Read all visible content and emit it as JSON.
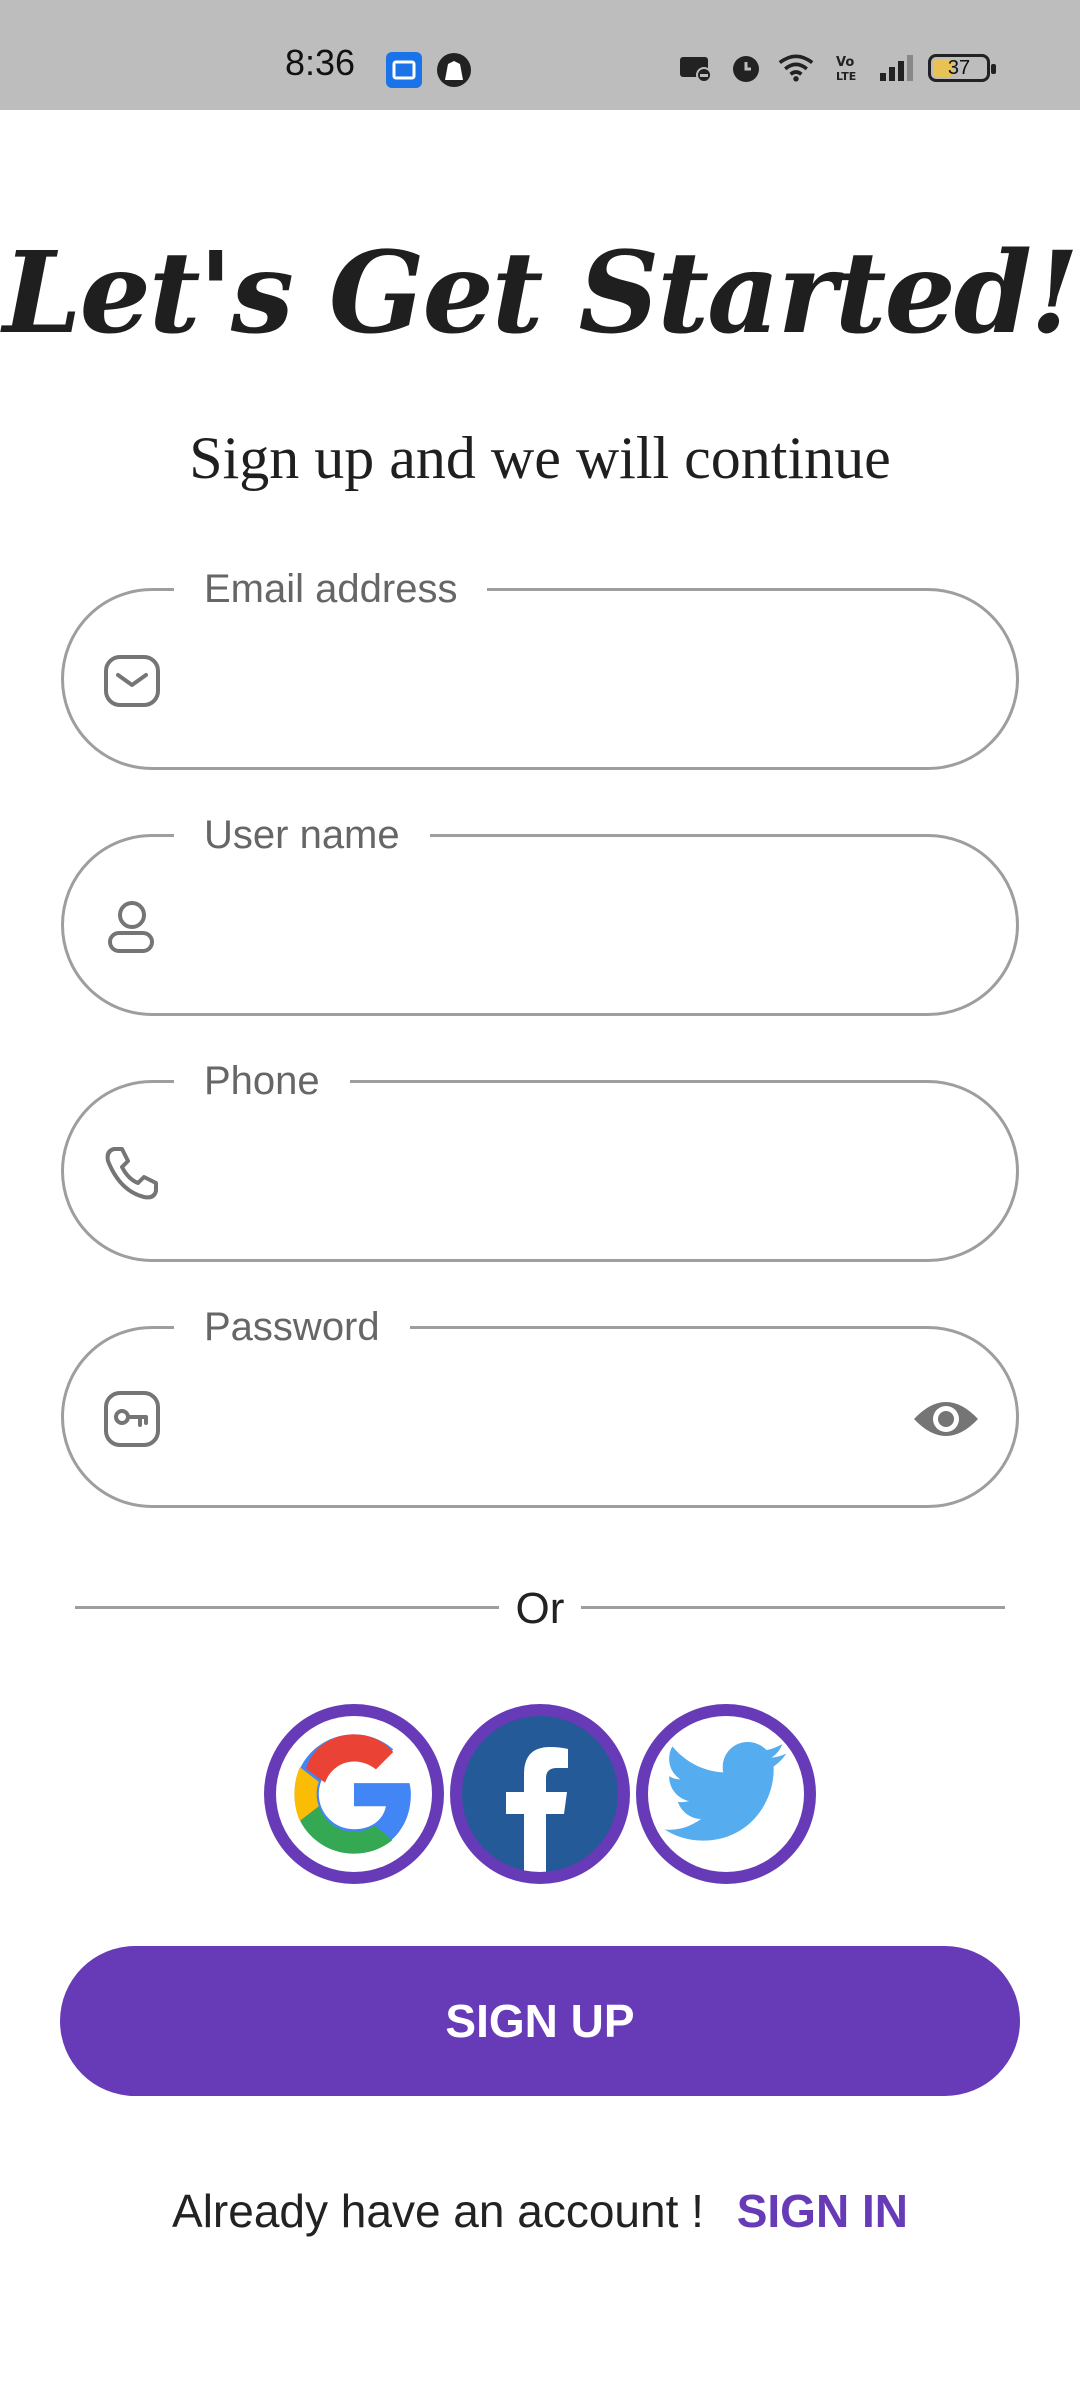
{
  "status_bar": {
    "time": "8:36",
    "battery": "37",
    "icons_left": [
      "app-notification-icon",
      "app-notification-icon-2"
    ],
    "icons_right": [
      "cast-icon",
      "alarm-icon",
      "wifi-icon",
      "volte-icon",
      "signal-icon",
      "battery-icon"
    ]
  },
  "header": {
    "title": "Let's Get Started!",
    "subtitle": "Sign up and we will continue"
  },
  "form": {
    "email": {
      "label": "Email address",
      "value": "",
      "icon": "mail-icon"
    },
    "username": {
      "label": "User name",
      "value": "",
      "icon": "user-icon"
    },
    "phone": {
      "label": "Phone",
      "value": "",
      "icon": "phone-icon"
    },
    "password": {
      "label": "Password",
      "value": "",
      "icon": "key-icon",
      "toggle_icon": "eye-icon"
    }
  },
  "divider": {
    "text": "Or"
  },
  "social": [
    {
      "name": "google",
      "icon": "google-icon"
    },
    {
      "name": "facebook",
      "icon": "facebook-icon"
    },
    {
      "name": "twitter",
      "icon": "twitter-icon"
    }
  ],
  "actions": {
    "signup_label": "SIGN UP",
    "signin_prompt": "Already have an account !",
    "signin_label": "SIGN IN"
  },
  "colors": {
    "accent": "#673ab7",
    "border": "#9e9e9e",
    "status_bar": "#bdbdbd"
  }
}
